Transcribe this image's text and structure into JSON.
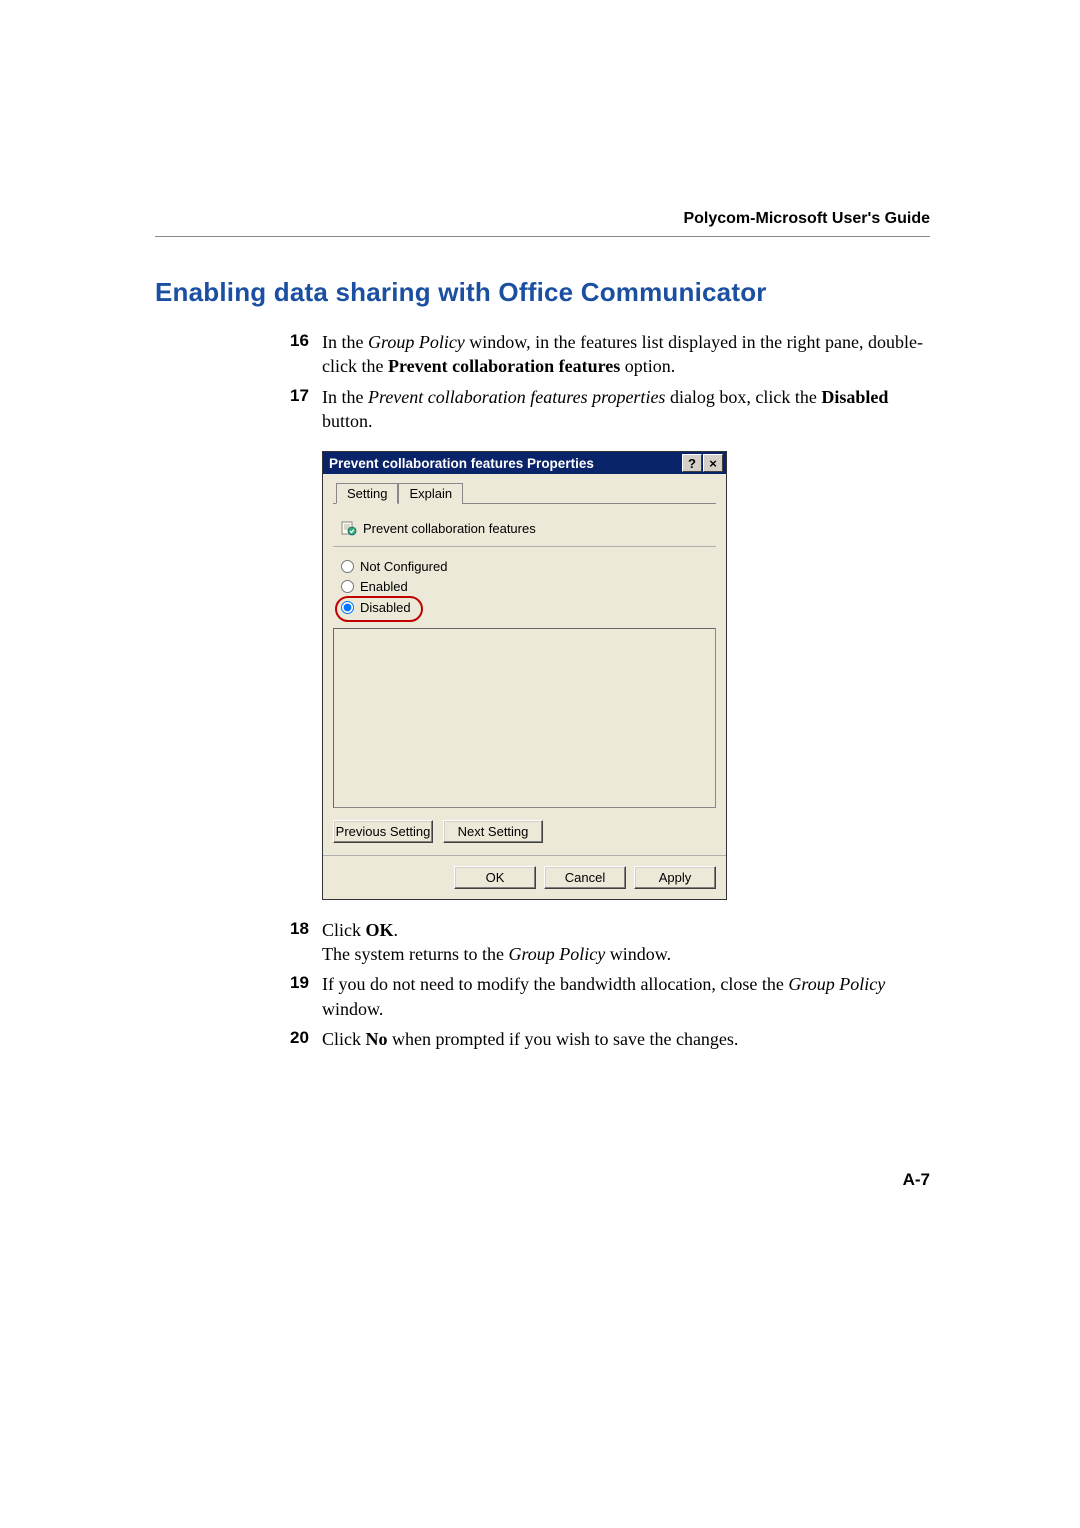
{
  "header": {
    "guide_title": "Polycom-Microsoft User's Guide"
  },
  "section": {
    "heading": "Enabling data sharing with Office Communicator"
  },
  "steps": {
    "s16": {
      "num": "16",
      "pre": "In the ",
      "em1": "Group Policy",
      "mid": " window, in the features list displayed in the right pane, double-click the ",
      "bold": "Prevent collaboration features",
      "post": " option."
    },
    "s17": {
      "num": "17",
      "pre": "In the ",
      "em1": "Prevent collaboration features properties",
      "mid": " dialog box, click the ",
      "bold": "Disabled",
      "post": " button."
    },
    "s18": {
      "num": "18",
      "line1_pre": "Click ",
      "line1_bold": "OK",
      "line1_post": ".",
      "line2_pre": "The system returns to the ",
      "line2_em": "Group Policy",
      "line2_post": " window."
    },
    "s19": {
      "num": "19",
      "pre": "If you do not need to modify the bandwidth allocation, close the ",
      "em1": "Group Policy",
      "post": " window."
    },
    "s20": {
      "num": "20",
      "pre": "Click ",
      "bold": "No",
      "post": " when prompted if you wish to save the changes."
    }
  },
  "dialog": {
    "title": "Prevent collaboration features Properties",
    "help_btn": "?",
    "close_btn": "×",
    "tabs": {
      "setting": "Setting",
      "explain": "Explain"
    },
    "policy_label": "Prevent collaboration features",
    "radios": {
      "not_configured": "Not Configured",
      "enabled": "Enabled",
      "disabled": "Disabled"
    },
    "nav": {
      "prev": "Previous Setting",
      "next": "Next Setting"
    },
    "buttons": {
      "ok": "OK",
      "cancel": "Cancel",
      "apply": "Apply"
    }
  },
  "footer": {
    "page_num": "A-7"
  }
}
